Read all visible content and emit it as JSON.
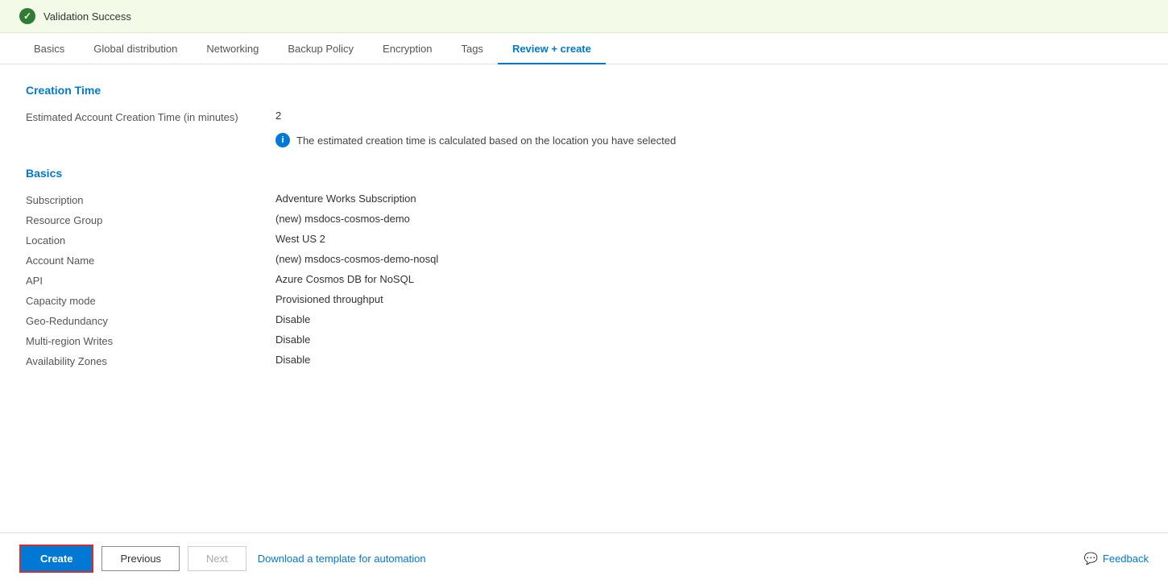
{
  "validation": {
    "text": "Validation Success"
  },
  "tabs": [
    {
      "id": "basics",
      "label": "Basics",
      "active": false
    },
    {
      "id": "global-distribution",
      "label": "Global distribution",
      "active": false
    },
    {
      "id": "networking",
      "label": "Networking",
      "active": false
    },
    {
      "id": "backup-policy",
      "label": "Backup Policy",
      "active": false
    },
    {
      "id": "encryption",
      "label": "Encryption",
      "active": false
    },
    {
      "id": "tags",
      "label": "Tags",
      "active": false
    },
    {
      "id": "review-create",
      "label": "Review + create",
      "active": true
    }
  ],
  "creation_time_section": {
    "title": "Creation Time",
    "rows": [
      {
        "label": "Estimated Account Creation Time (in minutes)",
        "value": "2"
      }
    ],
    "note": "The estimated creation time is calculated based on the location you have selected"
  },
  "basics_section": {
    "title": "Basics",
    "rows": [
      {
        "label": "Subscription",
        "value": "Adventure Works Subscription"
      },
      {
        "label": "Resource Group",
        "value": "(new) msdocs-cosmos-demo"
      },
      {
        "label": "Location",
        "value": "West US 2"
      },
      {
        "label": "Account Name",
        "value": "(new) msdocs-cosmos-demo-nosql"
      },
      {
        "label": "API",
        "value": "Azure Cosmos DB for NoSQL"
      },
      {
        "label": "Capacity mode",
        "value": "Provisioned throughput"
      },
      {
        "label": "Geo-Redundancy",
        "value": "Disable"
      },
      {
        "label": "Multi-region Writes",
        "value": "Disable"
      },
      {
        "label": "Availability Zones",
        "value": "Disable"
      }
    ]
  },
  "footer": {
    "create_label": "Create",
    "previous_label": "Previous",
    "next_label": "Next",
    "download_label": "Download a template for automation",
    "feedback_label": "Feedback"
  }
}
